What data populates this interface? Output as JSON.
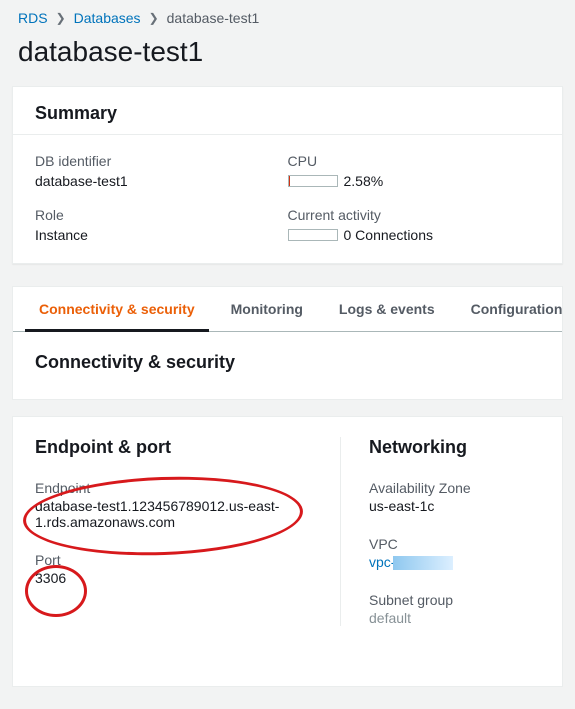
{
  "breadcrumb": {
    "root": "RDS",
    "databases": "Databases",
    "current": "database-test1"
  },
  "page_title": "database-test1",
  "summary": {
    "heading": "Summary",
    "db_identifier_label": "DB identifier",
    "db_identifier_value": "database-test1",
    "role_label": "Role",
    "role_value": "Instance",
    "cpu_label": "CPU",
    "cpu_value": "2.58%",
    "cpu_pct": 2.58,
    "activity_label": "Current activity",
    "activity_value": "0 Connections"
  },
  "tabs": {
    "connectivity": "Connectivity & security",
    "monitoring": "Monitoring",
    "logs": "Logs & events",
    "configuration": "Configuration"
  },
  "conn_sect": {
    "heading": "Connectivity & security",
    "endpoint_port_heading": "Endpoint & port",
    "endpoint_label": "Endpoint",
    "endpoint_value": "database-test1.123456789012.us-east-1.rds.amazonaws.com",
    "port_label": "Port",
    "port_value": "3306",
    "networking_heading": "Networking",
    "az_label": "Availability Zone",
    "az_value": "us-east-1c",
    "vpc_label": "VPC",
    "vpc_value": "vpc-",
    "subnet_label": "Subnet group",
    "subnet_value": "default"
  }
}
